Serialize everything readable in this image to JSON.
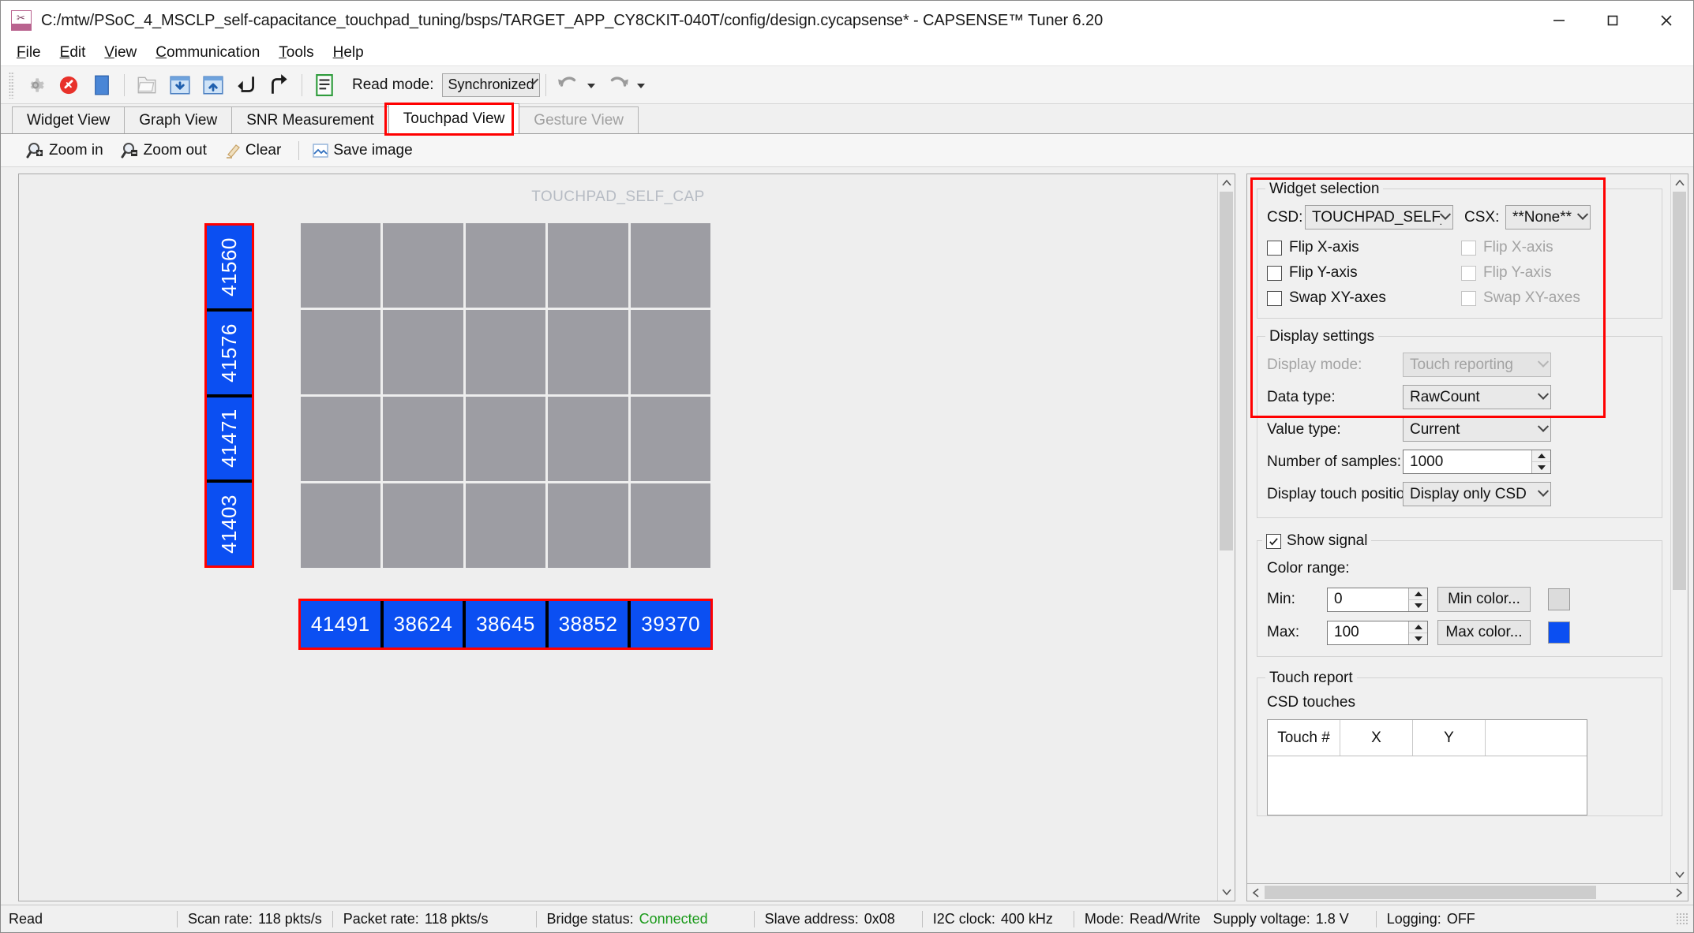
{
  "window": {
    "title": "C:/mtw/PSoC_4_MSCLP_self-capacitance_touchpad_tuning/bsps/TARGET_APP_CY8CKIT-040T/config/design.cycapsense* - CAPSENSE™ Tuner 6.20",
    "minimize_label": "Minimize",
    "maximize_label": "Maximize",
    "close_label": "Close"
  },
  "menubar": [
    {
      "label": "File",
      "mnemonic": "F"
    },
    {
      "label": "Edit",
      "mnemonic": "E"
    },
    {
      "label": "Communication",
      "mnemonic": "C"
    },
    {
      "label": "Tools",
      "mnemonic": "T"
    },
    {
      "label": "Help",
      "mnemonic": "H"
    }
  ],
  "toolbar": {
    "read_mode_label": "Read mode:",
    "read_mode_value": "Synchronized",
    "buttons": [
      {
        "name": "configure-widgets-icon",
        "tooltip": "Configure widgets"
      },
      {
        "name": "disconnect-icon",
        "tooltip": "Disconnect"
      },
      {
        "name": "stop-icon",
        "tooltip": "Stop"
      },
      {
        "name": "open-icon",
        "tooltip": "Open"
      },
      {
        "name": "import-icon",
        "tooltip": "Apply to device"
      },
      {
        "name": "export-icon",
        "tooltip": "Apply to project"
      },
      {
        "name": "to-device-icon",
        "tooltip": "Read from device"
      },
      {
        "name": "from-device-icon",
        "tooltip": "Write to device"
      },
      {
        "name": "log-icon",
        "tooltip": "Logging"
      }
    ]
  },
  "tabs": [
    {
      "label": "Widget View",
      "active": false,
      "disabled": false
    },
    {
      "label": "Graph View",
      "active": false,
      "disabled": false
    },
    {
      "label": "SNR Measurement",
      "active": false,
      "disabled": false
    },
    {
      "label": "Touchpad View",
      "active": true,
      "disabled": false
    },
    {
      "label": "Gesture View",
      "active": false,
      "disabled": true
    }
  ],
  "viewbar": [
    {
      "label": "Zoom in",
      "icon": "zoom-in-icon"
    },
    {
      "label": "Zoom out",
      "icon": "zoom-out-icon"
    },
    {
      "label": "Clear",
      "icon": "clear-icon"
    },
    {
      "label": "Save image",
      "icon": "save-image-icon"
    }
  ],
  "touchpad": {
    "widget_title": "TOUCHPAD_SELF_CAP",
    "row_sensors": [
      "41560",
      "41576",
      "41471",
      "41403"
    ],
    "col_sensors": [
      "41491",
      "38624",
      "38645",
      "38852",
      "39370"
    ],
    "grid_rows": 4,
    "grid_cols": 5,
    "cell_color": "#9d9da3",
    "active_color": "#0b4ff2",
    "highlight_color": "#ff0000"
  },
  "panel": {
    "widget_selection": {
      "title": "Widget selection",
      "csd_label": "CSD:",
      "csd_value": "TOUCHPAD_SELF_CAP",
      "csx_label": "CSX:",
      "csx_value": "**None**",
      "csd_options": [
        {
          "label": "Flip X-axis",
          "checked": false,
          "disabled": false
        },
        {
          "label": "Flip Y-axis",
          "checked": false,
          "disabled": false
        },
        {
          "label": "Swap XY-axes",
          "checked": false,
          "disabled": false
        }
      ],
      "csx_options": [
        {
          "label": "Flip X-axis",
          "checked": false,
          "disabled": true
        },
        {
          "label": "Flip Y-axis",
          "checked": false,
          "disabled": true
        },
        {
          "label": "Swap XY-axes",
          "checked": false,
          "disabled": true
        }
      ]
    },
    "display_settings": {
      "title": "Display settings",
      "fields": [
        {
          "label": "Display mode:",
          "value": "Touch reporting",
          "type": "combo",
          "disabled": true
        },
        {
          "label": "Data type:",
          "value": "RawCount",
          "type": "combo",
          "disabled": false
        },
        {
          "label": "Value type:",
          "value": "Current",
          "type": "combo",
          "disabled": false
        },
        {
          "label": "Number of samples:",
          "value": "1000",
          "type": "spinner",
          "disabled": false
        },
        {
          "label": "Display touch position:",
          "value": "Display only CSD",
          "type": "combo",
          "disabled": false
        }
      ]
    },
    "show_signal": {
      "title": "Show signal",
      "checked": true,
      "color_range_label": "Color range:",
      "min_label": "Min:",
      "min_value": "0",
      "min_button": "Min color...",
      "min_swatch": "#dcdcdc",
      "max_label": "Max:",
      "max_value": "100",
      "max_button": "Max color...",
      "max_swatch": "#0b4ff2"
    },
    "touch_report": {
      "title": "Touch report",
      "subtitle": "CSD touches",
      "columns": [
        "Touch #",
        "X",
        "Y"
      ],
      "rows": []
    }
  },
  "statusbar": {
    "state": "Read",
    "items": [
      {
        "key": "Scan rate:",
        "value": "118 pkts/s",
        "green": false
      },
      {
        "key": "Packet rate:",
        "value": "118 pkts/s",
        "green": false
      },
      {
        "key": "Bridge status:",
        "value": "Connected",
        "green": true
      },
      {
        "key": "Slave address:",
        "value": "0x08",
        "green": false
      },
      {
        "key": "I2C clock:",
        "value": "400 kHz",
        "green": false
      },
      {
        "key": "Mode:",
        "value": "Read/Write",
        "green": false
      },
      {
        "key": "Supply voltage:",
        "value": "1.8 V",
        "green": false
      },
      {
        "key": "Logging:",
        "value": "OFF",
        "green": false
      }
    ]
  }
}
